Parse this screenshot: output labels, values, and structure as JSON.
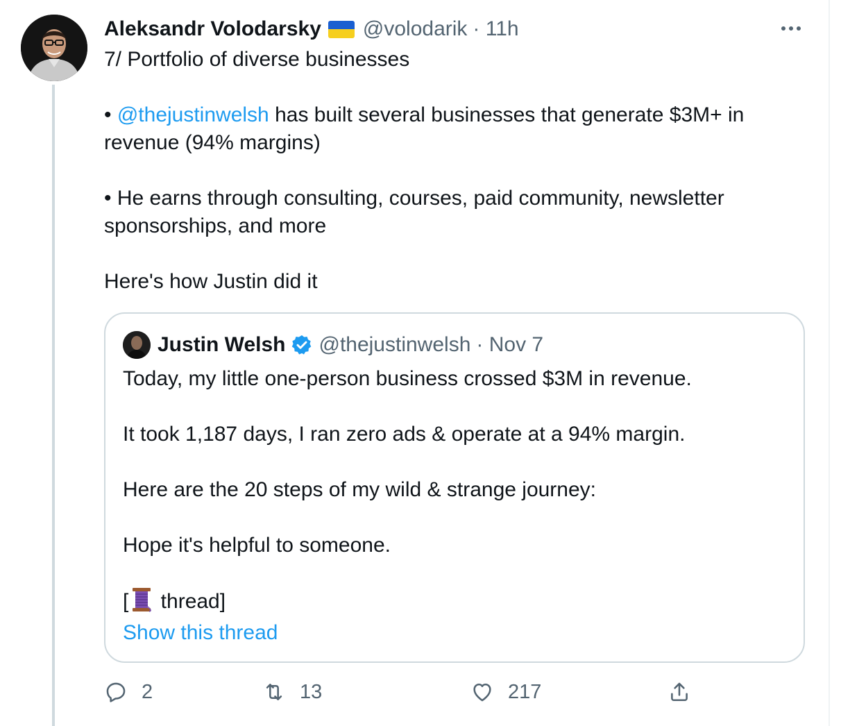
{
  "tweet": {
    "author_name": "Aleksandr Volodarsky",
    "author_flag": "ukraine-flag",
    "handle": "@volodarik",
    "time": "· 11h",
    "paragraphs": {
      "p1": "7/ Portfolio of diverse businesses",
      "p2_bullet": "• ",
      "p2_mention": "@thejustinwelsh",
      "p2_rest": " has built several businesses that generate $3M+ in revenue (94% margins)",
      "p3": "• He earns through consulting, courses, paid community, newsletter sponsorships, and more",
      "p4": "Here's how Justin did it"
    },
    "quote": {
      "author_name": "Justin Welsh",
      "handle": "@thejustinwelsh",
      "time": "· Nov 7",
      "lines": {
        "l1": "Today, my little one-person business crossed $3M in revenue.",
        "l2": "It took 1,187 days, I ran zero ads & operate at a 94% margin.",
        "l3": "Here are the 20 steps of my wild & strange journey:",
        "l4": "Hope it's helpful to someone.",
        "l5_open": "[",
        "l5_close": " thread]"
      },
      "show_thread": "Show this thread"
    },
    "actions": {
      "replies": "2",
      "retweets": "13",
      "likes": "217"
    }
  },
  "colors": {
    "link": "#1d9bf0",
    "muted": "#536471",
    "border": "#cfd9de"
  }
}
